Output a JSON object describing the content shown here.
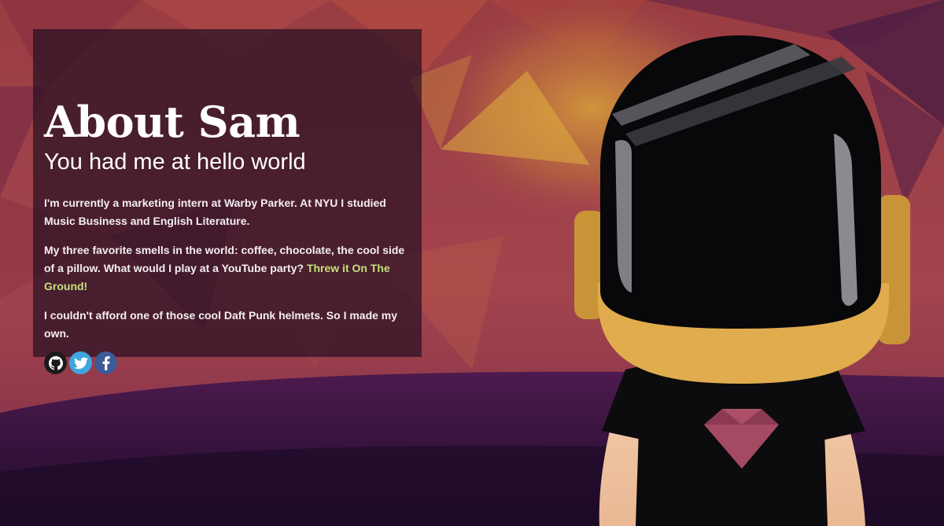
{
  "about": {
    "title": "About Sam",
    "subtitle": "You had me at hello world",
    "para1": "I'm currently a marketing intern at Warby Parker. At NYU I studied Music Business and English Literature.",
    "para2_text": "My three favorite smells in the world: coffee, chocolate, the cool side of a pillow. What would I play at a YouTube party? ",
    "para2_link": "Threw it On The Ground!",
    "para3": "I couldn't afford one of those cool Daft Punk helmets. So I made my own."
  },
  "social": [
    {
      "icon": "github-icon",
      "color": "#1d1a1e"
    },
    {
      "icon": "twitter-icon",
      "color": "#3fa6de"
    },
    {
      "icon": "facebook-icon",
      "color": "#3e5a98"
    }
  ],
  "colors": {
    "link": "#c6e07a",
    "helmet_visor": "#08080a",
    "helmet_gold": "#e0ac4e",
    "gem": "#8c3a52",
    "ground": "#2c1238"
  }
}
